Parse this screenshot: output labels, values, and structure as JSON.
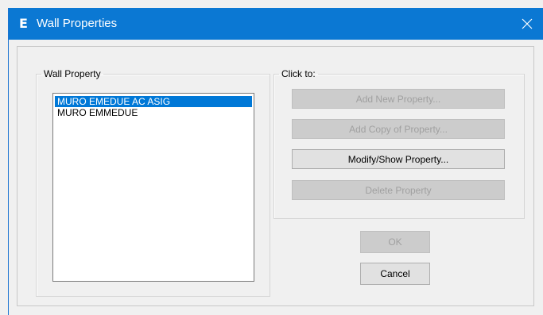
{
  "window": {
    "title": "Wall Properties",
    "app_icon_glyph": "E",
    "close_glyph": "✕"
  },
  "wall_property": {
    "legend": "Wall Property",
    "items": [
      {
        "label": "MURO EMEDUE AC ASIG",
        "selected": true
      },
      {
        "label": "MURO EMMEDUE",
        "selected": false
      }
    ]
  },
  "click_to": {
    "legend": "Click to:",
    "buttons": [
      {
        "label": "Add New Property...",
        "enabled": false
      },
      {
        "label": "Add Copy of Property...",
        "enabled": false
      },
      {
        "label": "Modify/Show Property...",
        "enabled": true
      },
      {
        "label": "Delete Property",
        "enabled": false
      }
    ]
  },
  "dialog_buttons": {
    "ok": {
      "label": "OK",
      "enabled": false
    },
    "cancel": {
      "label": "Cancel",
      "enabled": true
    }
  },
  "colors": {
    "titlebar": "#0b78d3",
    "selection": "#0078d7",
    "dialog_bg": "#f0f0f0"
  }
}
